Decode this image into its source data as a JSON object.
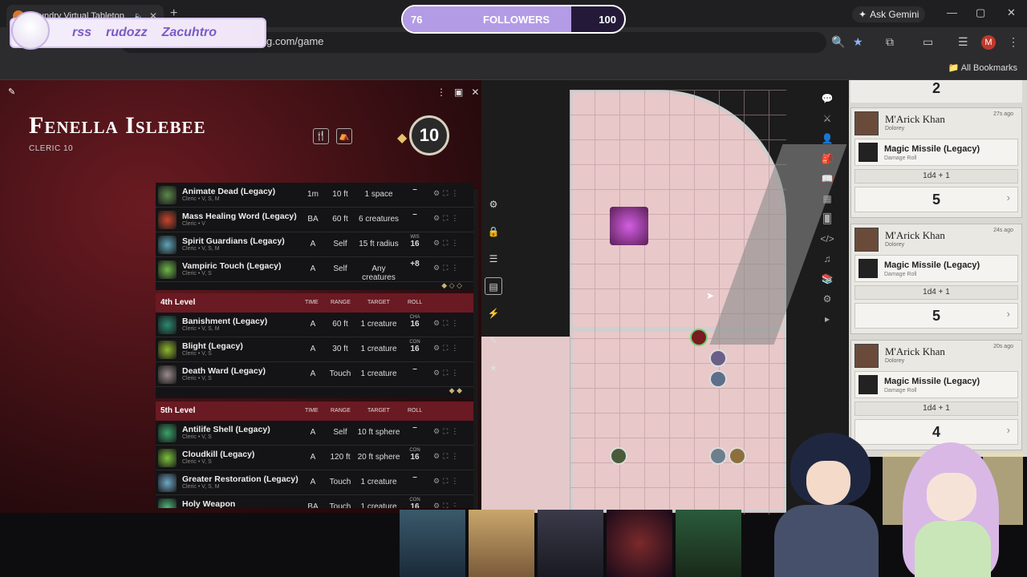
{
  "browser": {
    "tab_title": "Foundry Virtual Tabletop",
    "url": "g.com/game",
    "ask_gemini": "Ask Gemini",
    "all_bookmarks": "All Bookmarks",
    "profile_letter": "M"
  },
  "overlay": {
    "names": [
      "rss",
      "rudozz",
      "Zacuhtro"
    ],
    "followers_label": "FOLLOWERS",
    "followers_current": "76",
    "followers_goal": "100",
    "followers_progress": 0.76
  },
  "sheet": {
    "name": "Fenella Islebee",
    "class": "CLERIC 10",
    "level": "10",
    "spells_top": [
      {
        "name": "Animate Dead (Legacy)",
        "sub": "Cleric • V, S, M",
        "time": "1m",
        "range": "10 ft",
        "target": "1 space",
        "ability": "",
        "roll": "–",
        "color": "#5c8a4a"
      },
      {
        "name": "Mass Healing Word (Legacy)",
        "sub": "Cleric • V",
        "time": "BA",
        "range": "60 ft",
        "target": "6 creatures",
        "ability": "",
        "roll": "–",
        "color": "#c8452f"
      },
      {
        "name": "Spirit Guardians (Legacy)",
        "sub": "Cleric • V, S, M",
        "time": "A",
        "range": "Self",
        "target": "15 ft radius",
        "ability": "WIS",
        "roll": "16",
        "color": "#5fa3b8"
      },
      {
        "name": "Vampiric Touch (Legacy)",
        "sub": "Cleric • V, S",
        "time": "A",
        "range": "Self",
        "target": "Any creatures",
        "ability": "",
        "roll": "+8",
        "color": "#6fb84a"
      }
    ],
    "level4": {
      "label": "4th Level",
      "cols": [
        "TIME",
        "RANGE",
        "TARGET",
        "ROLL"
      ],
      "spells": [
        {
          "name": "Banishment (Legacy)",
          "sub": "Cleric • V, S, M",
          "time": "A",
          "range": "60 ft",
          "target": "1 creature",
          "ability": "CHA",
          "roll": "16",
          "color": "#2b8a73"
        },
        {
          "name": "Blight (Legacy)",
          "sub": "Cleric • V, S",
          "time": "A",
          "range": "30 ft",
          "target": "1 creature",
          "ability": "CON",
          "roll": "16",
          "color": "#8fb82f"
        },
        {
          "name": "Death Ward (Legacy)",
          "sub": "Cleric • V, S",
          "time": "A",
          "range": "Touch",
          "target": "1 creature",
          "ability": "",
          "roll": "–",
          "color": "#9a8b8b"
        }
      ]
    },
    "level5": {
      "label": "5th Level",
      "cols": [
        "TIME",
        "RANGE",
        "TARGET",
        "ROLL"
      ],
      "spells": [
        {
          "name": "Antilife Shell (Legacy)",
          "sub": "Cleric • V, S",
          "time": "A",
          "range": "Self",
          "target": "10 ft sphere",
          "ability": "",
          "roll": "–",
          "color": "#3aa36a"
        },
        {
          "name": "Cloudkill (Legacy)",
          "sub": "Cleric • V, S",
          "time": "A",
          "range": "120 ft",
          "target": "20 ft sphere",
          "ability": "CON",
          "roll": "16",
          "color": "#7cc23a"
        },
        {
          "name": "Greater Restoration (Legacy)",
          "sub": "Cleric • V, S, M",
          "time": "A",
          "range": "Touch",
          "target": "1 creature",
          "ability": "",
          "roll": "–",
          "color": "#6fa8c8"
        },
        {
          "name": "Holy Weapon",
          "sub": "Cleric • V, S",
          "time": "BA",
          "range": "Touch",
          "target": "1 creature",
          "ability": "CON",
          "roll": "16",
          "color": "#4fb87a"
        }
      ]
    }
  },
  "chat": {
    "top_total": "2",
    "rolls": [
      {
        "speaker": "M'Arick Khan",
        "alias": "Dolorey",
        "ago": "27s ago",
        "spell": "Magic Missile (Legacy)",
        "type": "Damage Roll",
        "formula": "1d4 + 1",
        "total": "5"
      },
      {
        "speaker": "M'Arick Khan",
        "alias": "Dolorey",
        "ago": "24s ago",
        "spell": "Magic Missile (Legacy)",
        "type": "Damage Roll",
        "formula": "1d4 + 1",
        "total": "5"
      },
      {
        "speaker": "M'Arick Khan",
        "alias": "Dolorey",
        "ago": "20s ago",
        "spell": "Magic Missile (Legacy)",
        "type": "Damage Roll",
        "formula": "1d4 + 1",
        "total": "4"
      }
    ]
  }
}
